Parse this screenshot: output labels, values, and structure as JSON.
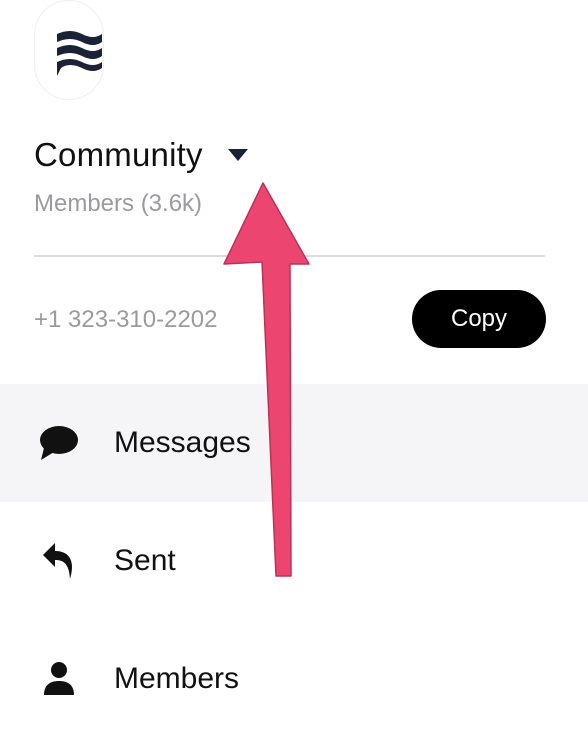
{
  "header": {
    "logo_icon": "flag-icon",
    "title": "Community",
    "dropdown_icon": "caret-down-icon",
    "members_text": "Members (3.6k)"
  },
  "contact": {
    "phone": "+1 323-310-2202",
    "copy_label": "Copy"
  },
  "menu": {
    "items": [
      {
        "label": "Messages",
        "icon": "chat-bubble-icon",
        "active": true
      },
      {
        "label": "Sent",
        "icon": "reply-arrow-icon",
        "active": false
      },
      {
        "label": "Members",
        "icon": "person-icon",
        "active": false
      }
    ]
  },
  "annotation": {
    "icon": "pointer-arrow-icon",
    "color": "#ec4670"
  }
}
